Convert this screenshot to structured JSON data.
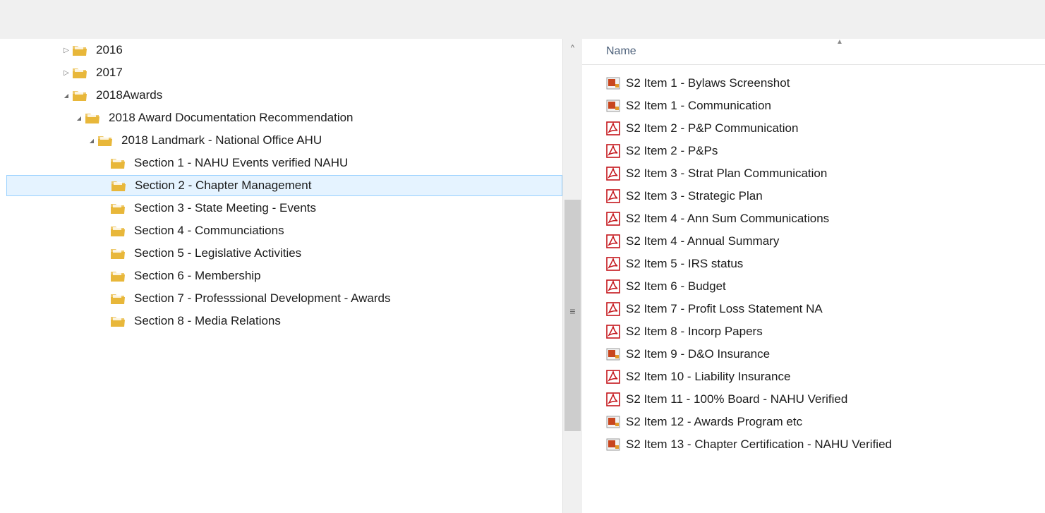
{
  "colors": {
    "folder": "#e8b73a",
    "selection_bg": "#e5f3ff",
    "selection_border": "#99d1ff",
    "pdf_red": "#c4161c",
    "img_orange": "#c8461f",
    "header_text": "#4c607a"
  },
  "tree": {
    "items": [
      {
        "label": "2016",
        "expander": "▷",
        "icon": "folder-icon"
      },
      {
        "label": "2017",
        "expander": "▷",
        "icon": "folder-icon"
      },
      {
        "label": "2018Awards",
        "expander": "◢",
        "icon": "folder-icon"
      },
      {
        "label": "2018 Award Documentation Recommendation",
        "expander": "◢",
        "icon": "folder-icon"
      },
      {
        "label": "2018 Landmark - National Office AHU",
        "expander": "◢",
        "icon": "folder-icon"
      },
      {
        "label": "Section 1 - NAHU Events verified NAHU",
        "expander": "",
        "icon": "folder-icon"
      },
      {
        "label": "Section 2 - Chapter Management",
        "expander": "",
        "icon": "folder-icon",
        "selected": true
      },
      {
        "label": "Section 3 - State Meeting - Events",
        "expander": "",
        "icon": "folder-icon"
      },
      {
        "label": "Section 4 - Communciations",
        "expander": "",
        "icon": "folder-icon"
      },
      {
        "label": "Section 5 - Legislative Activities",
        "expander": "",
        "icon": "folder-icon"
      },
      {
        "label": "Section 6 - Membership",
        "expander": "",
        "icon": "folder-icon"
      },
      {
        "label": "Section 7 - Professsional Development - Awards",
        "expander": "",
        "icon": "folder-icon"
      },
      {
        "label": "Section 8 - Media Relations",
        "expander": "",
        "icon": "folder-icon"
      }
    ]
  },
  "scrollbar": {
    "up_arrow": "^",
    "grip": "≡"
  },
  "file_list": {
    "column_name": "Name",
    "sort_indicator": "▲",
    "files": [
      {
        "name": "S2 Item 1 - Bylaws Screenshot",
        "type": "image"
      },
      {
        "name": "S2 Item 1 - Communication",
        "type": "image"
      },
      {
        "name": "S2 Item 2 - P&P Communication",
        "type": "pdf"
      },
      {
        "name": "S2 Item 2 - P&Ps",
        "type": "pdf"
      },
      {
        "name": "S2 Item 3 - Strat Plan Communication",
        "type": "pdf"
      },
      {
        "name": "S2 Item 3 - Strategic Plan",
        "type": "pdf"
      },
      {
        "name": "S2 Item 4 - Ann Sum Communications",
        "type": "pdf"
      },
      {
        "name": "S2 Item 4 - Annual Summary",
        "type": "pdf"
      },
      {
        "name": "S2 Item 5 - IRS status",
        "type": "pdf"
      },
      {
        "name": "S2 Item 6 - Budget",
        "type": "pdf"
      },
      {
        "name": "S2 Item 7 - Profit Loss Statement NA",
        "type": "pdf"
      },
      {
        "name": "S2 Item 8 - Incorp Papers",
        "type": "pdf"
      },
      {
        "name": "S2 Item 9 - D&O Insurance",
        "type": "image"
      },
      {
        "name": "S2 Item 10 - Liability Insurance",
        "type": "pdf"
      },
      {
        "name": "S2 Item 11 - 100% Board - NAHU Verified",
        "type": "pdf"
      },
      {
        "name": "S2 Item 12 - Awards Program etc",
        "type": "image"
      },
      {
        "name": "S2 Item 13 - Chapter Certification - NAHU Verified",
        "type": "image"
      }
    ]
  }
}
